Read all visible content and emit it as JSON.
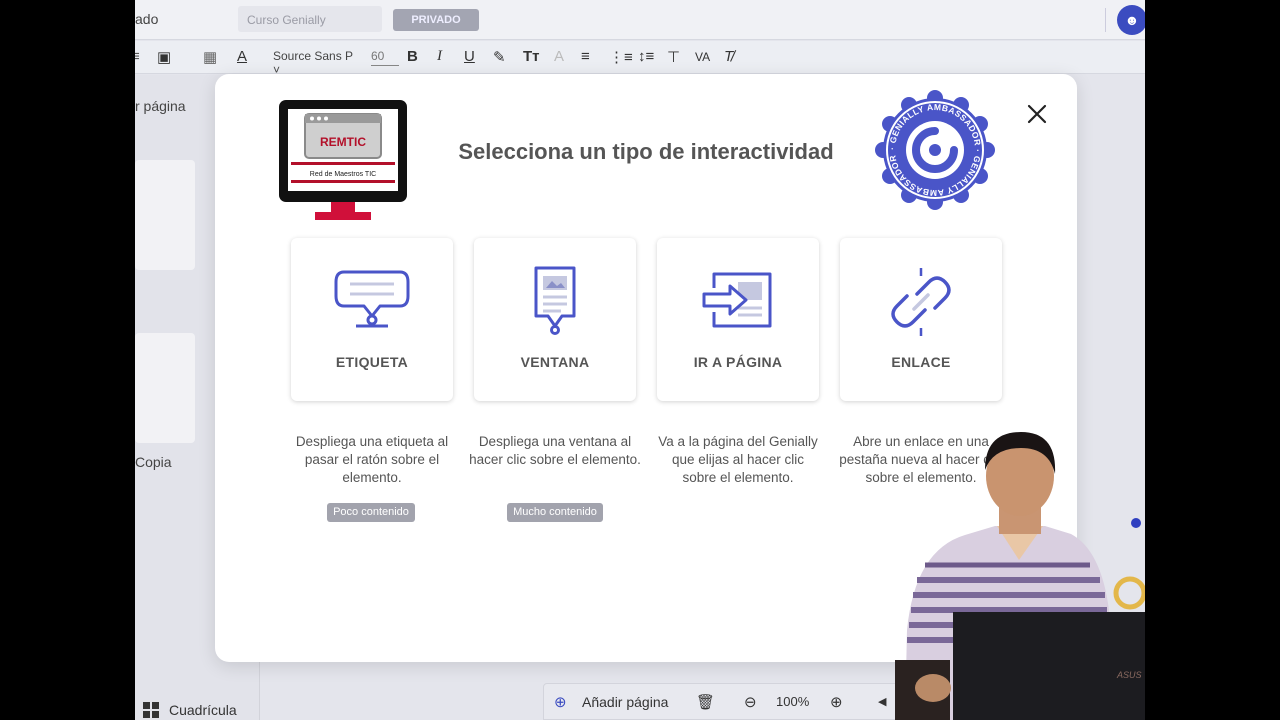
{
  "editor": {
    "title_fragment": "ado",
    "course_name": "Curso Genially",
    "privacy_badge": "PRIVADO",
    "toolbar": {
      "font_family": "Source Sans P",
      "font_size": "60"
    },
    "left_panel": {
      "add_page_label": "r página",
      "copy_label": "Copia",
      "grid_label": "Cuadrícula"
    },
    "bottom_bar": {
      "add_page_label": "Añadir página",
      "zoom": "100%"
    }
  },
  "modal": {
    "title": "Selecciona un tipo de interactividad",
    "logo_text": "REMTIC",
    "logo_subtext": "Red de Maestros TIC",
    "seal_text": "· GENIALLY AMBASSADOR · GENIALLY AMBASSADOR",
    "cards": [
      {
        "label": "ETIQUETA",
        "icon": "tooltip-bubble-icon",
        "description": "Despliega una etiqueta al pasar el ratón sobre el elemento.",
        "tag": "Poco contenido"
      },
      {
        "label": "VENTANA",
        "icon": "window-document-icon",
        "description": "Despliega una ventana al hacer clic sobre el elemento.",
        "tag": "Mucho contenido"
      },
      {
        "label": "IR A PÁGINA",
        "icon": "go-to-page-icon",
        "description": "Va a la página del Genially que elijas al hacer clic sobre el elemento.",
        "tag": ""
      },
      {
        "label": "ENLACE",
        "icon": "link-chain-icon",
        "description": "Abre un enlace en una pestaña nueva al hacer clic sobre el elemento.",
        "tag": ""
      }
    ],
    "accent_color": "#4a55c8"
  },
  "overlay": {
    "laptop_brand": "ASUS"
  }
}
